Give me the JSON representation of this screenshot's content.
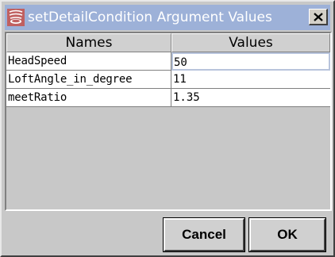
{
  "window": {
    "title": "setDetailCondition Argument Values",
    "app_icon": "java-app-icon",
    "close_icon": "close-icon"
  },
  "table": {
    "columns": [
      "Names",
      "Values"
    ],
    "rows": [
      {
        "name": "HeadSpeed",
        "value": "50"
      },
      {
        "name": "LoftAngle_in_degree",
        "value": "11"
      },
      {
        "name": "meetRatio",
        "value": "1.35"
      }
    ]
  },
  "buttons": {
    "cancel_label": "Cancel",
    "ok_label": "OK"
  }
}
